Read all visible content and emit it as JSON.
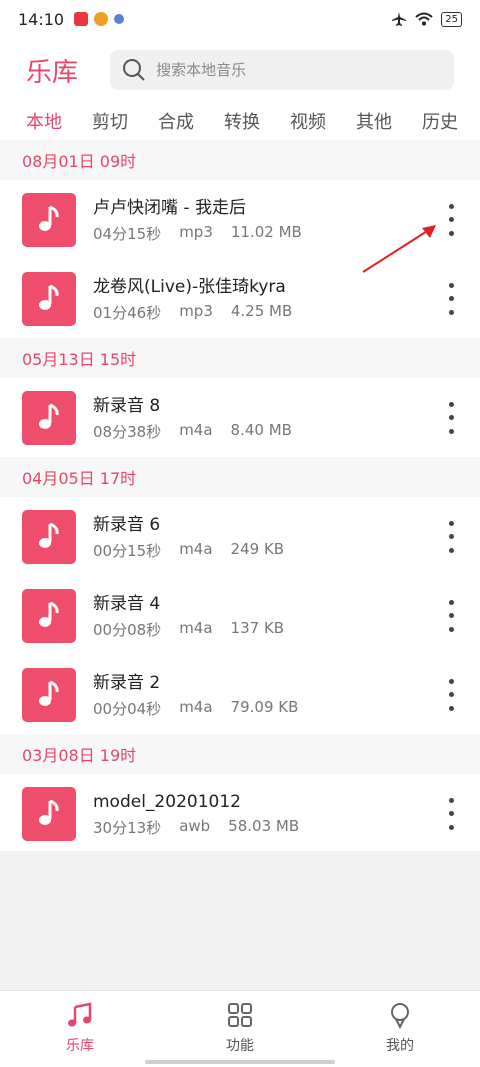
{
  "status": {
    "time": "14:10",
    "battery": "25",
    "icons": [
      "airplane-icon",
      "wifi-icon",
      "battery-icon"
    ]
  },
  "header": {
    "title": "乐库",
    "search_placeholder": "搜索本地音乐"
  },
  "tabs": [
    {
      "label": "本地",
      "active": true
    },
    {
      "label": "剪切",
      "active": false
    },
    {
      "label": "合成",
      "active": false
    },
    {
      "label": "转换",
      "active": false
    },
    {
      "label": "视频",
      "active": false
    },
    {
      "label": "其他",
      "active": false
    },
    {
      "label": "历史",
      "active": false
    }
  ],
  "groups": [
    {
      "date": "08月01日  09时",
      "items": [
        {
          "title": "卢卢快闭嘴 - 我走后",
          "duration": "04分15秒",
          "format": "mp3",
          "size": "11.02 MB"
        },
        {
          "title": "龙卷风(Live)-张佳琦kyra",
          "duration": "01分46秒",
          "format": "mp3",
          "size": "4.25 MB"
        }
      ]
    },
    {
      "date": "05月13日  15时",
      "items": [
        {
          "title": "新录音 8",
          "duration": "08分38秒",
          "format": "m4a",
          "size": "8.40 MB"
        }
      ]
    },
    {
      "date": "04月05日  17时",
      "items": [
        {
          "title": "新录音 6",
          "duration": "00分15秒",
          "format": "m4a",
          "size": "249 KB"
        },
        {
          "title": "新录音 4",
          "duration": "00分08秒",
          "format": "m4a",
          "size": "137 KB"
        },
        {
          "title": "新录音 2",
          "duration": "00分04秒",
          "format": "m4a",
          "size": "79.09 KB"
        }
      ]
    },
    {
      "date": "03月08日  19时",
      "items": [
        {
          "title": "model_20201012",
          "duration": "30分13秒",
          "format": "awb",
          "size": "58.03 MB"
        }
      ]
    }
  ],
  "bottom_nav": [
    {
      "label": "乐库",
      "icon": "music-note-icon",
      "active": true
    },
    {
      "label": "功能",
      "icon": "grid-icon",
      "active": false
    },
    {
      "label": "我的",
      "icon": "profile-icon",
      "active": false
    }
  ],
  "colors": {
    "accent": "#e5476b",
    "thumb": "#ee4d6c",
    "annotation_arrow": "#e02020"
  }
}
